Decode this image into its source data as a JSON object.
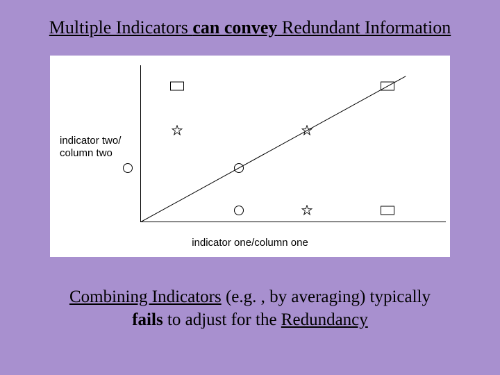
{
  "title": {
    "parts": [
      {
        "text": "Multiple Indicators ",
        "style": "u"
      },
      {
        "text": "can convey",
        "style": "ub"
      },
      {
        "text": " Redundant Information",
        "style": "u"
      }
    ]
  },
  "chart_data": {
    "type": "scatter",
    "xlabel": "indicator one/column one",
    "ylabel": "indicator two/\ncolumn two",
    "xlim": [
      0,
      4.5
    ],
    "ylim": [
      0,
      4.5
    ],
    "diagonal": {
      "from": [
        0,
        0
      ],
      "to": [
        4.3,
        4.3
      ]
    },
    "points": [
      {
        "x": 0.6,
        "y": 4.0,
        "shape": "square"
      },
      {
        "x": 4.0,
        "y": 4.0,
        "shape": "square"
      },
      {
        "x": 0.6,
        "y": 2.7,
        "shape": "star"
      },
      {
        "x": 2.7,
        "y": 2.7,
        "shape": "star"
      },
      {
        "x": -0.2,
        "y": 1.6,
        "shape": "circle"
      },
      {
        "x": 1.6,
        "y": 1.6,
        "shape": "circle"
      },
      {
        "x": 1.6,
        "y": 0.35,
        "shape": "circle"
      },
      {
        "x": 2.7,
        "y": 0.35,
        "shape": "star"
      },
      {
        "x": 4.0,
        "y": 0.35,
        "shape": "square"
      }
    ]
  },
  "caption": {
    "line1": [
      {
        "text": "Combining Indicators",
        "style": "u"
      },
      {
        "text": " (e.g. , by averaging) typically",
        "style": ""
      }
    ],
    "line2": [
      {
        "text": "fails",
        "style": "b"
      },
      {
        "text": " to adjust for the ",
        "style": ""
      },
      {
        "text": "Redundancy",
        "style": "u"
      }
    ]
  }
}
